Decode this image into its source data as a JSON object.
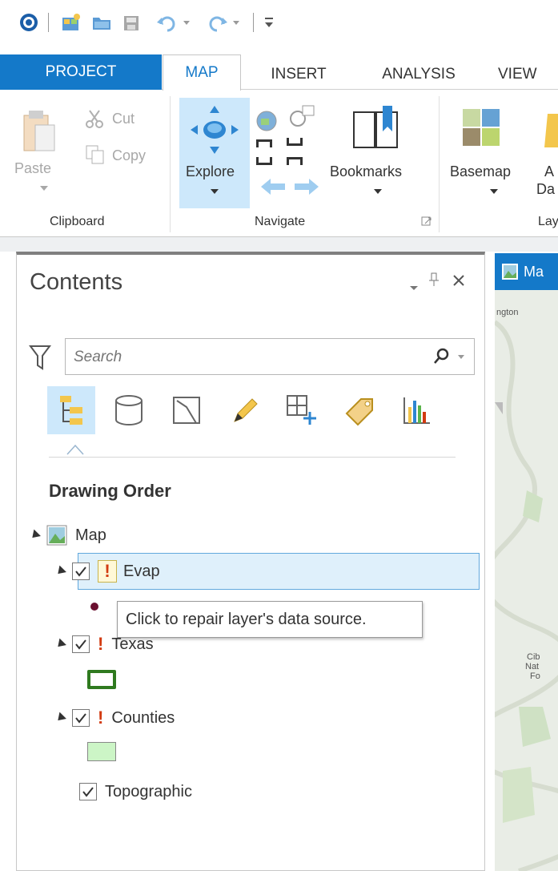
{
  "ribbon_tabs": [
    "PROJECT",
    "MAP",
    "INSERT",
    "ANALYSIS",
    "VIEW"
  ],
  "clipboard": {
    "paste_label": "Paste",
    "cut_label": "Cut",
    "copy_label": "Copy",
    "group_label": "Clipboard"
  },
  "navigate": {
    "explore_label": "Explore",
    "bookmarks_label": "Bookmarks",
    "group_label": "Navigate"
  },
  "layer_group": {
    "basemap_label": "Basemap",
    "add_data_label_line1": "A",
    "add_data_label_line2": "Da",
    "group_label_partial": "Lay"
  },
  "contents_pane": {
    "title": "Contents",
    "search_placeholder": "Search",
    "section_title": "Drawing Order"
  },
  "layers": {
    "map_label": "Map",
    "evap_label": "Evap",
    "texas_label": "Texas",
    "counties_label": "Counties",
    "topographic_label": "Topographic"
  },
  "tooltip": {
    "text": "Click to repair layer's data source."
  },
  "map_view": {
    "tab_label_partial": "Ma",
    "label_ngton": "ngton",
    "label_ci": "Cib",
    "label_nat": "Nat",
    "label_fo": "Fo"
  },
  "colors": {
    "accent_blue": "#1479c9",
    "selection_blue": "#cde8fb",
    "warning_red": "#d23a10",
    "texas_symbol_green": "#2f7a1f",
    "counties_symbol_fill": "#ccf5c6"
  }
}
